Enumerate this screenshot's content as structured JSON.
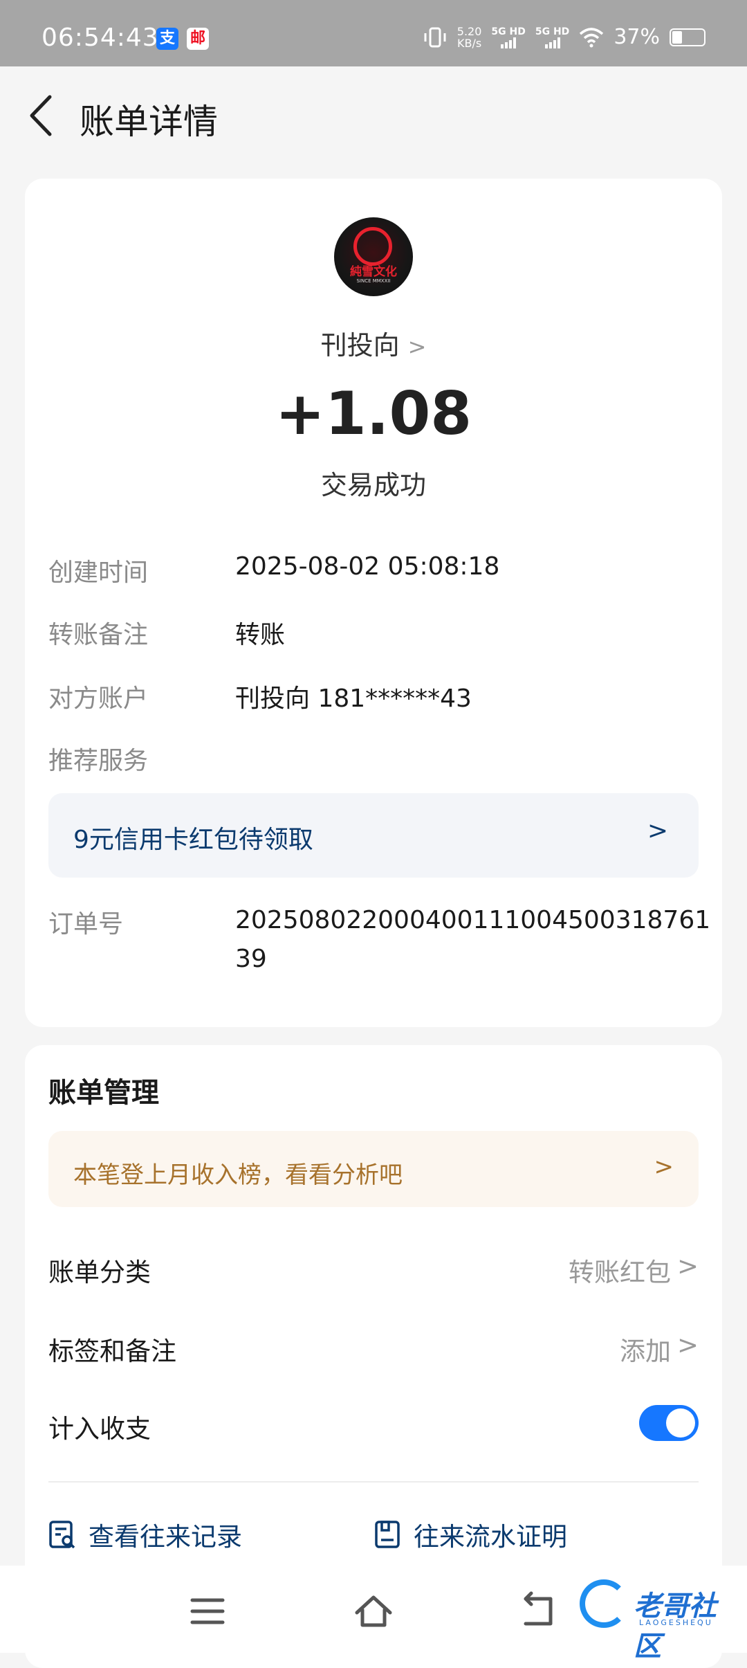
{
  "status_bar": {
    "time": "06:54:43",
    "app_icons": [
      "支",
      "邮"
    ],
    "net_speed": "5.20",
    "net_unit": "KB/s",
    "signal1": "5G HD",
    "signal2": "5G HD",
    "battery": "37%",
    "battery_level": 0.37
  },
  "header": {
    "title": "账单详情"
  },
  "payee": {
    "name": "刊投向",
    "avatar_brand": "純雪文化",
    "avatar_sub": "SINCE MMXXII"
  },
  "transaction": {
    "amount": "+1.08",
    "status": "交易成功"
  },
  "details": [
    {
      "label": "创建时间",
      "value": "2025-08-02 05:08:18"
    },
    {
      "label": "转账备注",
      "value": "转账"
    },
    {
      "label": "对方账户",
      "value": "刊投向 181******43"
    },
    {
      "label": "推荐服务",
      "value": ""
    }
  ],
  "promo": {
    "text": "9元信用卡红包待领取"
  },
  "order": {
    "label": "订单号",
    "value": "20250802200040011100450031876139"
  },
  "management": {
    "title": "账单管理",
    "tip": "本笔登上月收入榜，看看分析吧",
    "category_label": "账单分类",
    "category_value": "转账红包",
    "tags_label": "标签和备注",
    "tags_value": "添加",
    "count_label": "计入收支",
    "count_enabled": true,
    "link1": "查看往来记录",
    "link2": "往来流水证明"
  },
  "watermark": {
    "text": "老哥社区",
    "sub": "LAOGESHEQU"
  },
  "colors": {
    "accent": "#1677ff",
    "link": "#0b3a6e",
    "tip": "#a7722c"
  }
}
